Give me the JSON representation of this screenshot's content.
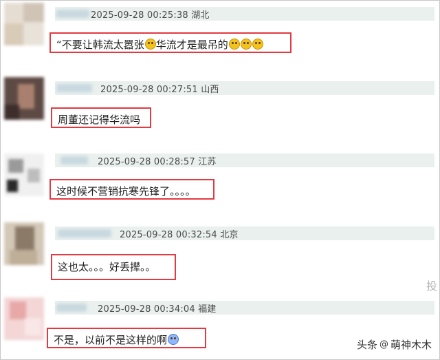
{
  "comments": [
    {
      "time": "2025-09-28 00:25:38",
      "region": "湖北",
      "text": "“不要让韩流太嚣张",
      "text_tail": "华流才是最吊的",
      "emoji_icons": [
        "laugh-emoji-icon",
        "laugh-emoji-icon",
        "laugh-emoji-icon",
        "laugh-emoji-icon"
      ]
    },
    {
      "time": "2025-09-28 00:27:51",
      "region": "山西",
      "text": "周董还记得华流吗"
    },
    {
      "time": "2025-09-28 00:28:57",
      "region": "江苏",
      "text": "这时候不营销抗寒先锋了。。。。"
    },
    {
      "time": "2025-09-28 00:32:54",
      "region": "北京",
      "text": "这也太。。。好丢撵。。"
    },
    {
      "time": "2025-09-28 00:34:04",
      "region": "福建",
      "text": "不是，以前不是这样的啊",
      "emoji_icons": [
        "scared-emoji-icon"
      ]
    }
  ],
  "edge_char": "投",
  "watermark": {
    "platform": "头条",
    "author": "萌神木木",
    "at_symbol": "@"
  },
  "colors": {
    "highlight": "#e23a40",
    "meta_bg": "#e9f0ee"
  }
}
